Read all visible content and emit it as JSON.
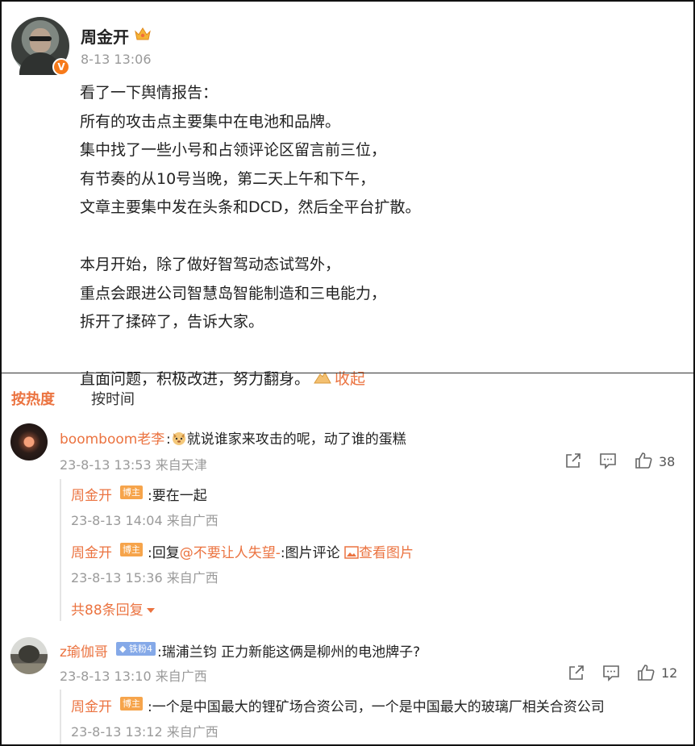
{
  "post": {
    "author": "周金开",
    "verified": "V",
    "time": "8-13 13:06",
    "lines1": [
      "看了一下舆情报告：",
      "所有的攻击点主要集中在电池和品牌。",
      "集中找了一些小号和占领评论区留言前三位，",
      "有节奏的从10号当晚，第二天上午和下午，",
      "文章主要集中发在头条和DCD，然后全平台扩散。"
    ],
    "lines2": [
      "本月开始，除了做好智驾动态试驾外，",
      "重点会跟进公司智慧岛智能制造和三电能力，",
      "拆开了揉碎了，告诉大家。"
    ],
    "last_line": "直面问题，积极改进，努力翻身。",
    "collapse_label": "收起"
  },
  "sort": {
    "hot": "按热度",
    "time": "按时间"
  },
  "comments": [
    {
      "name": "boomboom老李",
      "text": "就说谁家来攻击的呢，动了谁的蛋糕",
      "meta": "23-8-13 13:53 来自天津",
      "likes": "38",
      "replies": [
        {
          "name": "周金开",
          "tag": "博主",
          "text": ":要在一起",
          "meta": "23-8-13 14:04 来自广西"
        },
        {
          "name": "周金开",
          "tag": "博主",
          "prefix": ":回复",
          "mention": "@不要让人失望-",
          "mid": ":图片评论 ",
          "pic_link": "查看图片",
          "meta": "23-8-13 15:36 来自广西"
        }
      ],
      "more": "共88条回复"
    },
    {
      "name": "z瑜伽哥",
      "fan_tag": "铁粉4",
      "text": ":瑞浦兰钧 正力新能这俩是柳州的电池牌子?",
      "meta": "23-8-13 13:10 来自广西",
      "likes": "12",
      "replies": [
        {
          "name": "周金开",
          "tag": "博主",
          "text": ":一个是中国最大的锂矿场合资公司，一个是中国最大的玻璃厂相关合资公司",
          "meta": "23-8-13 13:12 来自广西"
        }
      ]
    }
  ],
  "colors": {
    "accent": "#eb7340",
    "tag": "#f6a44b",
    "fan": "#85a9e8"
  }
}
